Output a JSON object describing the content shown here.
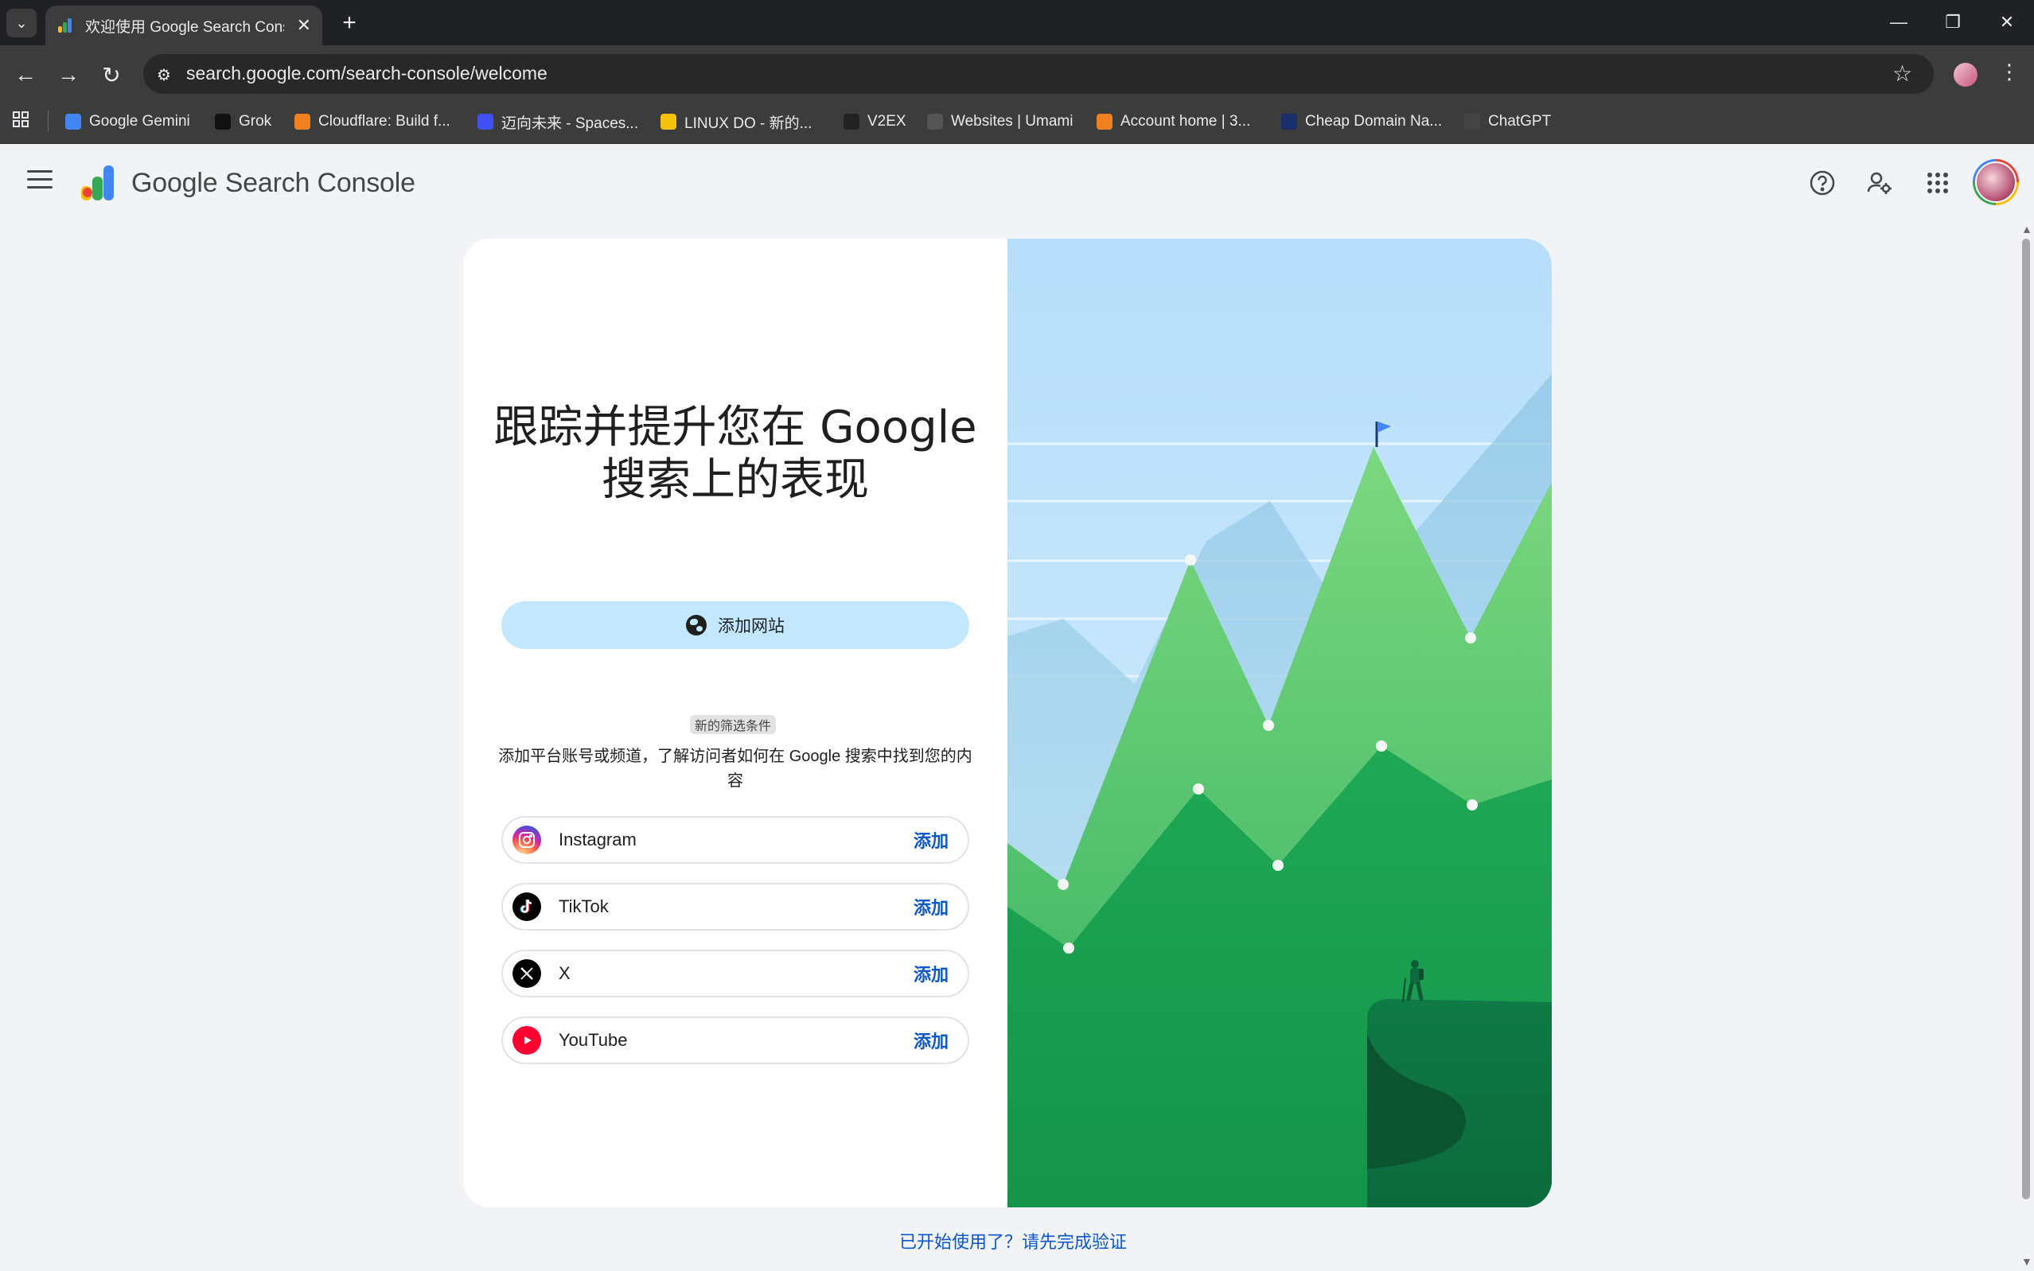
{
  "browser": {
    "tab_title": "欢迎使用 Google Search Console",
    "url": "search.google.com/search-console/welcome",
    "bookmarks": [
      {
        "label": "Google Gemini",
        "color": "#4285f4"
      },
      {
        "label": "Grok",
        "color": "#111111"
      },
      {
        "label": "Cloudflare: Build f...",
        "color": "#f38020"
      },
      {
        "label": "迈向未来 - Spaces...",
        "color": "#3f51f5"
      },
      {
        "label": "LINUX DO - 新的...",
        "color": "#f4c20d"
      },
      {
        "label": "V2EX",
        "color": "#222222"
      },
      {
        "label": "Websites | Umami",
        "color": "#555555"
      },
      {
        "label": "Account home | 3...",
        "color": "#f38020"
      },
      {
        "label": "Cheap Domain Na...",
        "color": "#1a2e6b"
      },
      {
        "label": "ChatGPT",
        "color": "#444444"
      }
    ]
  },
  "header": {
    "product_google": "Google",
    "product_name": "Search Console"
  },
  "main": {
    "headline_line1": "跟踪并提升您在 Google",
    "headline_line2": "搜索上的表现",
    "add_site_label": "添加网站",
    "new_chip": "新的筛选条件",
    "platform_desc": "添加平台账号或频道，了解访问者如何在 Google 搜索中找到您的内容",
    "platforms": [
      {
        "name": "Instagram",
        "action": "添加"
      },
      {
        "name": "TikTok",
        "action": "添加"
      },
      {
        "name": "X",
        "action": "添加"
      },
      {
        "name": "YouTube",
        "action": "添加"
      }
    ],
    "verify_link": "已开始使用了？请先完成验证"
  },
  "colors": {
    "accent_blue": "#0b57d0",
    "button_bg": "#c2e7ff",
    "sky": "#bde3fb",
    "mountain_green": "#34b86a",
    "page_bg": "#f1f3f7"
  }
}
